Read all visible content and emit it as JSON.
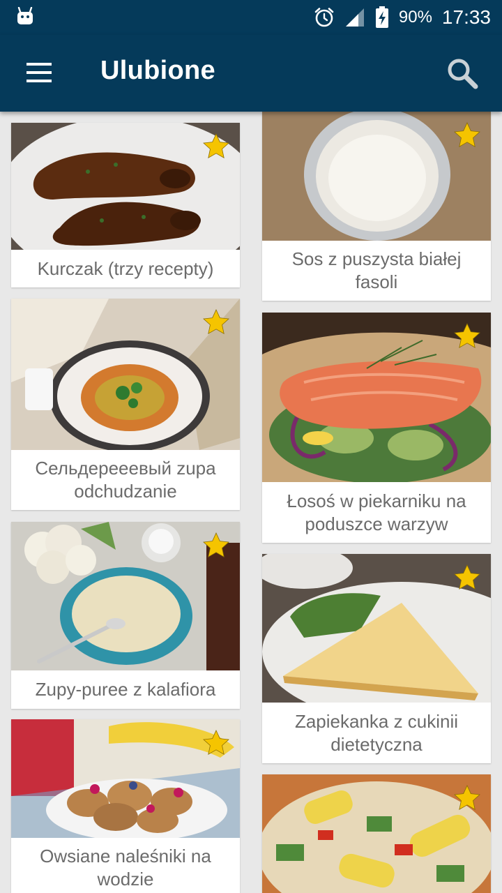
{
  "status_bar": {
    "battery_percent": "90%",
    "time": "17:33"
  },
  "app_bar": {
    "title": "Ulubione"
  },
  "icons": {
    "menu": "hamburger-menu-icon",
    "search": "search-icon",
    "favorite": "star-icon"
  },
  "colors": {
    "primary": "#053a5a",
    "star": "#f5c400",
    "caption_text": "#6b6b6b",
    "background": "#e8e8e8"
  },
  "recipes": {
    "left": [
      {
        "title": "Kurczak (trzy recepty)",
        "favorite": true
      },
      {
        "title": "Сельдерееевый zupa odchudzanie",
        "favorite": true
      },
      {
        "title": "Zupy-puree z kalafiora",
        "favorite": true
      },
      {
        "title": "Owsiane naleśniki na wodzie",
        "favorite": true
      }
    ],
    "right": [
      {
        "title": "Sos z puszysta białej fasoli",
        "favorite": true
      },
      {
        "title": "Łosoś w piekarniku na poduszce warzyw",
        "favorite": true
      },
      {
        "title": "Zapiekanka z cukinii dietetyczna",
        "favorite": true
      },
      {
        "title": "",
        "favorite": true
      }
    ]
  }
}
